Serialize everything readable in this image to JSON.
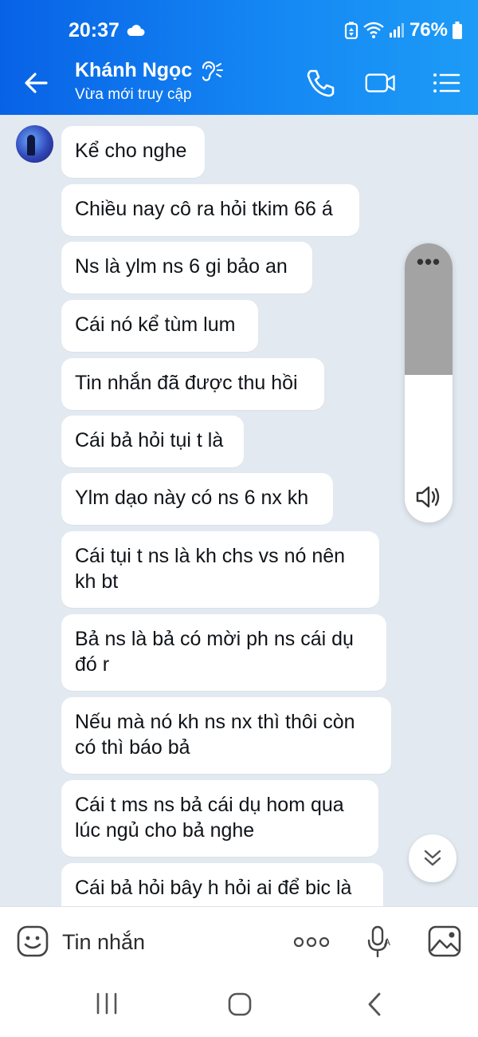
{
  "status_bar": {
    "time": "20:37",
    "battery": "76%"
  },
  "header": {
    "contact_name": "Khánh Ngọc",
    "contact_status": "Vừa mới truy cập"
  },
  "messages": [
    "Kể cho nghe",
    "Chiều nay cô ra hỏi tkim 66 á",
    "Ns là ylm ns 6 gi bảo an",
    "Cái nó kể tùm lum",
    "Tin nhắn đã được thu hồi",
    "Cái bả hỏi tụi t là",
    "Ylm dạo này có ns 6 nx kh",
    "Cái tụi t ns là kh chs vs nó nên kh bt",
    "Bả ns là bả có mời ph ns cái dụ đó r",
    "Nếu mà nó kh ns nx thì thôi còn có thì báo bả",
    "Cái t ms ns bả cái dụ hom qua lúc ngủ cho bả nghe",
    "Cái bả hỏi bây h hỏi ai để bic là"
  ],
  "volume": {
    "level": 0.53
  },
  "input": {
    "placeholder": "Tin nhắn"
  },
  "colors": {
    "header_start": "#0862e6",
    "header_end": "#1d9bf6",
    "chat_bg": "#e2e9f1",
    "bubble": "#ffffff"
  }
}
